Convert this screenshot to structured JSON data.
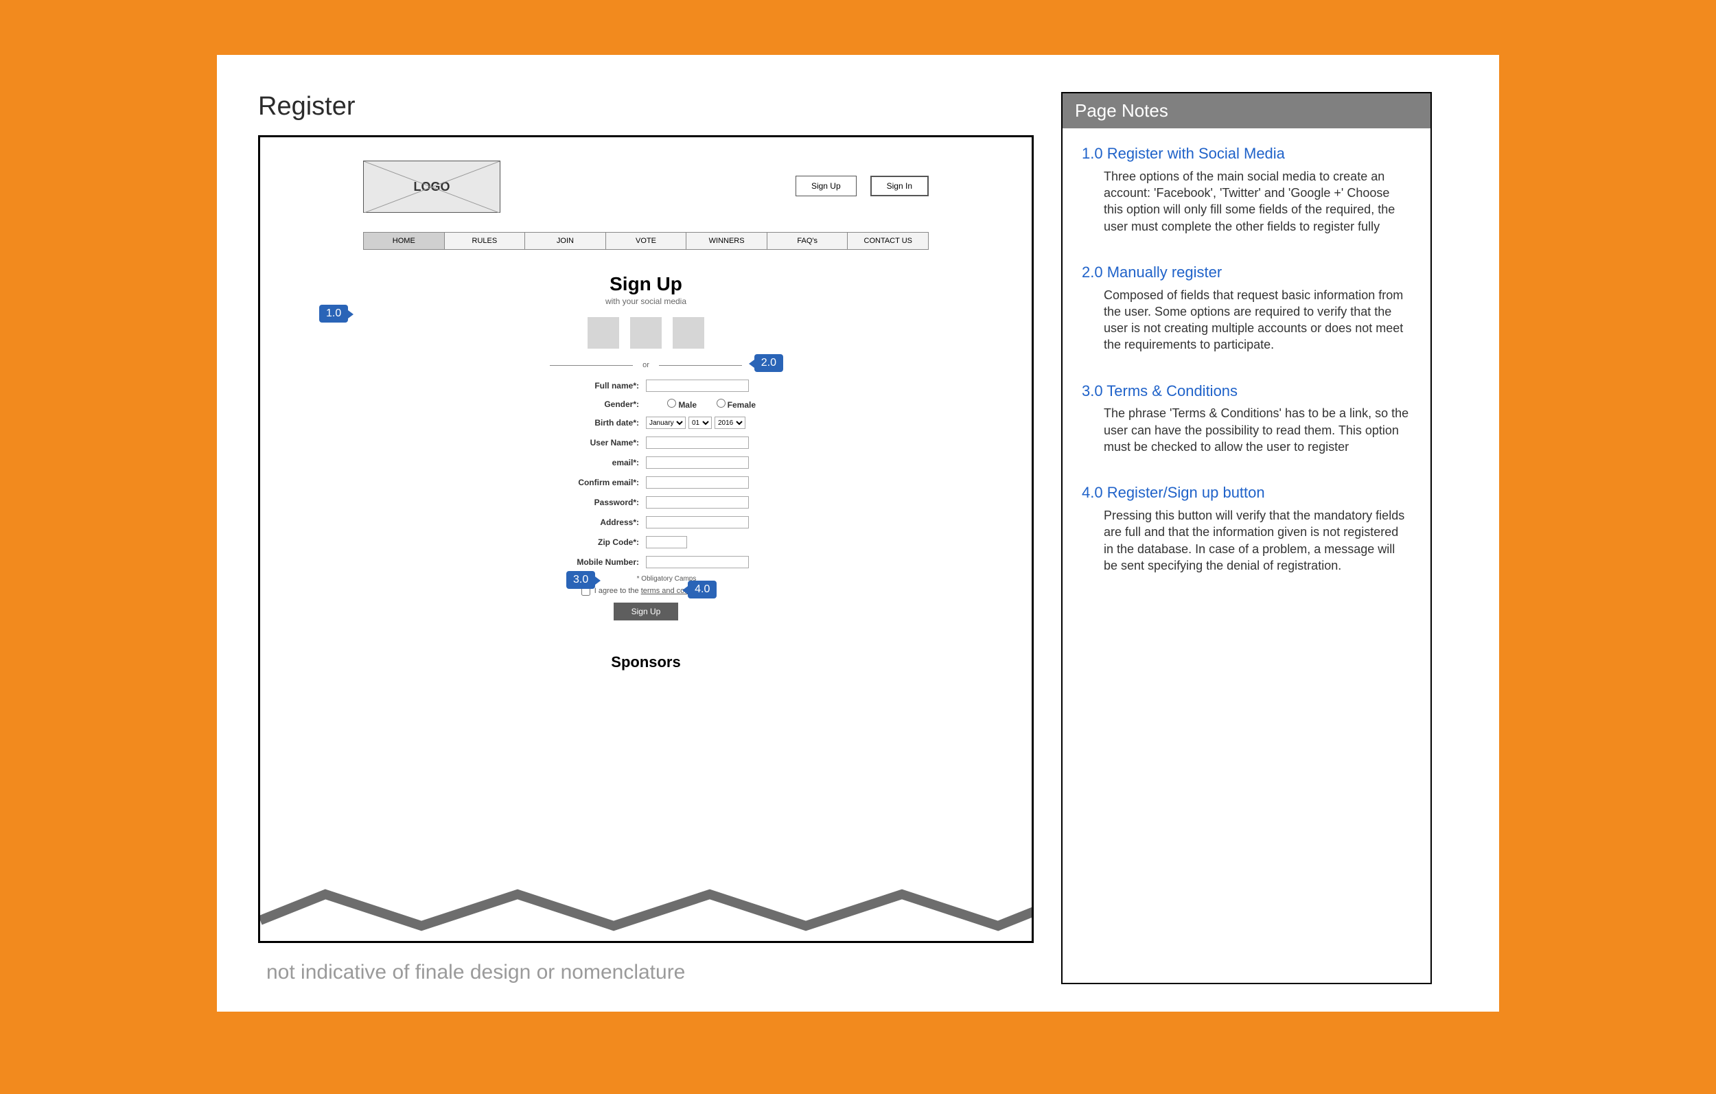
{
  "page": {
    "title": "Register",
    "disclaimer": "not indicative of finale design or nomenclature"
  },
  "wireframe": {
    "logo_text": "LOGO",
    "header_buttons": {
      "signup": "Sign Up",
      "signin": "Sign In"
    },
    "nav": [
      "HOME",
      "RULES",
      "JOIN",
      "VOTE",
      "WINNERS",
      "FAQ's",
      "CONTACT US"
    ],
    "nav_active_index": 0,
    "signup_heading": "Sign Up",
    "signup_sub": "with your  social media",
    "divider_text": "or",
    "fields": {
      "full_name": "Full name*:",
      "gender": "Gender*:",
      "gender_male": "Male",
      "gender_female": "Female",
      "birth_date": "Birth date*:",
      "birth_month": "January",
      "birth_day": "01",
      "birth_year": "2016",
      "user_name": "User Name*:",
      "email": "email*:",
      "confirm_email": "Confirm email*:",
      "password": "Password*:",
      "address": "Address*:",
      "zip": "Zip Code*:",
      "mobile": "Mobile Number:",
      "obligatory": "* Obligatory Camps",
      "terms_prefix": "I agree to the ",
      "terms_link": "terms and conditions"
    },
    "signup_button": "Sign Up",
    "sponsors_heading": "Sponsors",
    "callouts": {
      "c1": "1.0",
      "c2": "2.0",
      "c3": "3.0",
      "c4": "4.0"
    }
  },
  "notes": {
    "header": "Page Notes",
    "items": [
      {
        "title": "1.0 Register with Social Media",
        "body": "Three options of the main social media to create an account: 'Facebook', 'Twitter' and 'Google +' Choose this option will only fill some fields of the required, the user must complete the other fields to register fully"
      },
      {
        "title": "2.0 Manually register",
        "body": "Composed of fields that request basic information from the user. Some options are required to verify that the user is not creating multiple accounts or does not meet the requirements to participate."
      },
      {
        "title": "3.0 Terms & Conditions",
        "body": "The phrase 'Terms & Conditions' has to be a link, so the user can have the possibility to read them. This option must be checked to allow the user to register"
      },
      {
        "title": "4.0 Register/Sign up button",
        "body": "Pressing this button will verify that the mandatory fields are full and that the information given is not registered in the database. In case of a problem, a message will be sent specifying the denial of registration."
      }
    ]
  }
}
